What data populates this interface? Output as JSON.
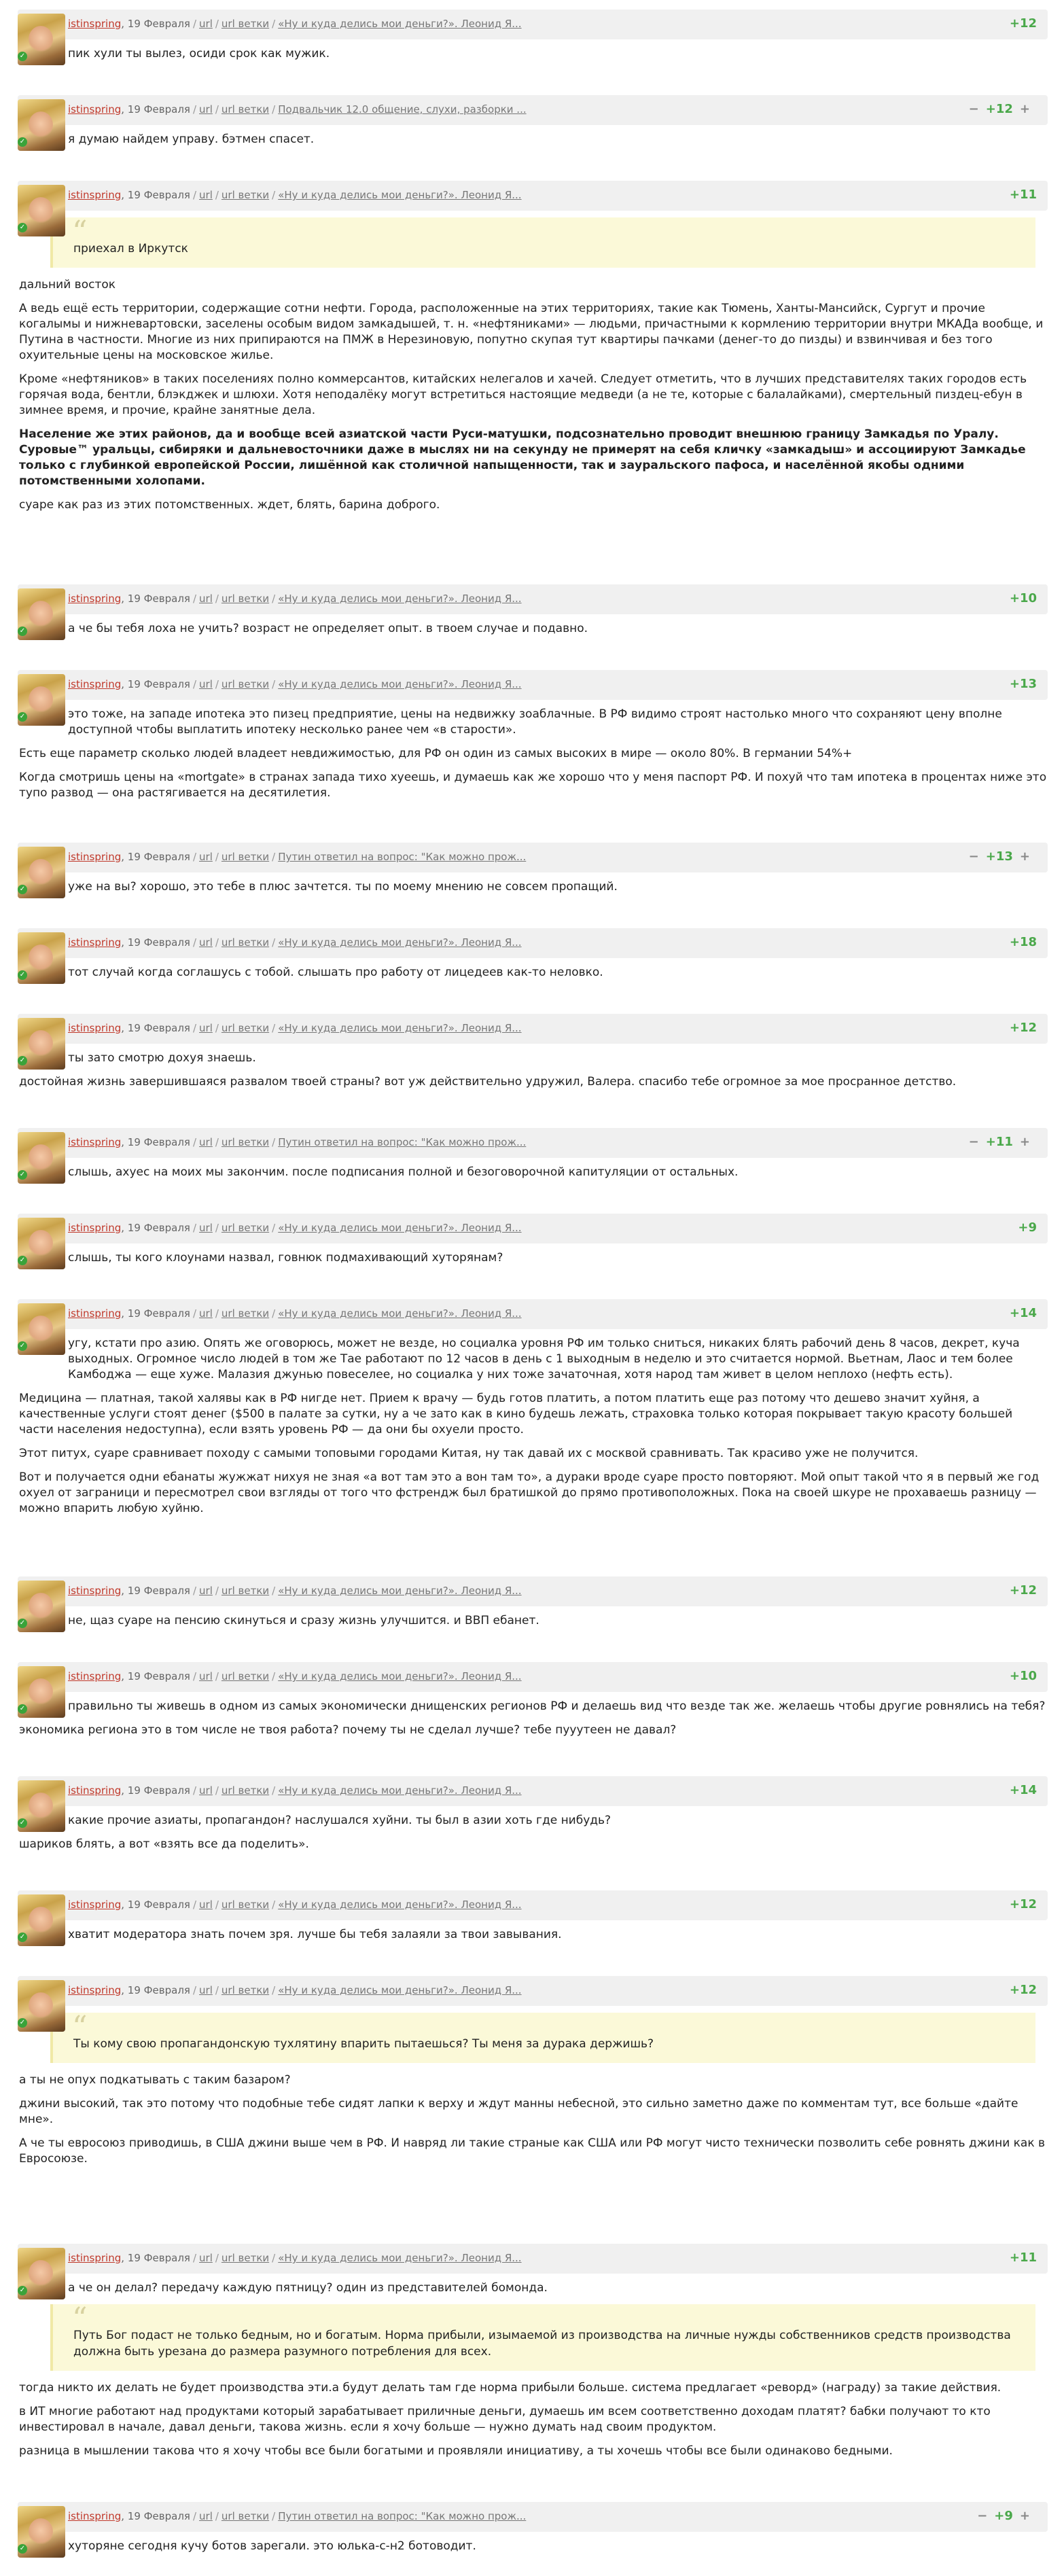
{
  "labels": {
    "user": "istinspring",
    "date": "19 Февраля",
    "url": "url",
    "branch": "url ветки",
    "sep": "/",
    "minus": "−",
    "plus": "+"
  },
  "comments": [
    {
      "thread": "«Ну и куда делись мои деньги?». Леонид Я...",
      "score": "+12",
      "controls": false,
      "body": [
        {
          "t": "пик хули ты вылез, осиди срок как мужик."
        }
      ]
    },
    {
      "thread": "Подвальчик 12.0 общение, слухи, разборки ...",
      "score": "+12",
      "controls": true,
      "body": [
        {
          "t": "я думаю найдем управу. бэтмен спасет."
        }
      ]
    },
    {
      "thread": "«Ну и куда делись мои деньги?». Леонид Я...",
      "score": "+11",
      "controls": false,
      "quote": "приехал в Иркутск",
      "body": [
        {
          "t": "дальний восток"
        },
        {
          "t": "А ведь ещё есть территории, содержащие сотни нефти. Города, расположенные на этих территориях, такие как Тюмень, Ханты-Мансийск, Сургут и прочие когалымы и нижневартовски, заселены особым видом замкадышей, т. н. «нефтяниками» — людьми, причастными к кормлению территории внутри МКАДа вообще, и Путина в частности. Многие из них припираются на ПМЖ в Нерезиновую, попутно скупая тут квартиры пачками (денег-то до пизды) и взвинчивая и без того охуительные цены на московское жилье."
        },
        {
          "t": "Кроме «нефтяников» в таких поселениях полно коммерсантов, китайских нелегалов и хачей. Следует отметить, что в лучших представителях таких городов есть горячая вода, бентли, блэкджек и шлюхи. Хотя неподалёку могут встретиться настоящие медведи (а не те, которые с балалайками), смертельный пиздец-ебун в зимнее время, и прочие, крайне занятные дела."
        },
        {
          "t": "Население же этих районов, да и вообще всей азиатской части Руси-матушки, подсознательно проводит внешнюю границу Замкадья по Уралу. Суровые™ уральцы, сибиряки и дальневосточники даже в мыслях ни на секунду не примерят на себя кличку «замкадыш» и ассоциируют Замкадье только с глубинкой европейской России, лишённой как столичной напыщенности, так и зауральского пафоса, и населённой якобы одними потомственными холопами.",
          "bold": true
        },
        {
          "t": "суаре как раз из этих потомственных. ждет, блять, барина доброго."
        }
      ]
    },
    {
      "thread": "«Ну и куда делись мои деньги?». Леонид Я...",
      "score": "+10",
      "controls": false,
      "body": [
        {
          "t": "а че бы тебя лоха не учить? возраст не определяет опыт. в твоем случае и подавно."
        }
      ]
    },
    {
      "thread": "«Ну и куда делись мои деньги?». Леонид Я...",
      "score": "+13",
      "controls": false,
      "body": [
        {
          "t": "это тоже, на западе ипотека это пизец предприятие, цены на недвижку зоаблачные. В РФ видимо строят настолько много что сохраняют цену вполне доступной чтобы выплатить ипотеку несколько ранее чем «в старости»."
        },
        {
          "t": "Есть еще параметр сколько людей владеет невдижимостью, для РФ он один из самых высоких в мире — около 80%. В германии 54%+"
        },
        {
          "t": "Когда смотришь цены на «mortgate» в странах запада тихо хуеешь, и думаешь как же хорошо что у меня паспорт РФ. И похуй что там ипотека в процентах ниже это тупо развод — она растягивается на десятилетия."
        }
      ]
    },
    {
      "thread": "Путин ответил на вопрос: \"Как можно прож...",
      "score": "+13",
      "controls": true,
      "body": [
        {
          "t": "уже на вы? хорошо, это тебе в плюс зачтется. ты по моему мнению не совсем пропащий."
        }
      ]
    },
    {
      "thread": "«Ну и куда делись мои деньги?». Леонид Я...",
      "score": "+18",
      "controls": false,
      "body": [
        {
          "t": "тот случай когда соглашусь с тобой. слышать про работу от лицедеев как-то неловко."
        }
      ]
    },
    {
      "thread": "«Ну и куда делись мои деньги?». Леонид Я...",
      "score": "+12",
      "controls": false,
      "body": [
        {
          "t": "ты зато смотрю дохуя знаешь."
        },
        {
          "t": "достойная жизнь завершившаяся развалом твоей страны? вот уж действительно удружил, Валера. спасибо тебе огромное за мое просранное детство."
        }
      ]
    },
    {
      "thread": "Путин ответил на вопрос: \"Как можно прож...",
      "score": "+11",
      "controls": true,
      "body": [
        {
          "t": "слышь, ахуес на моих мы закончим. после подписания полной и безоговорочной капитуляции от остальных."
        }
      ]
    },
    {
      "thread": "«Ну и куда делись мои деньги?». Леонид Я...",
      "score": "+9",
      "controls": false,
      "body": [
        {
          "t": "слышь, ты кого клоунами назвал, говнюк подмахивающий хуторянам?"
        }
      ]
    },
    {
      "thread": "«Ну и куда делись мои деньги?». Леонид Я...",
      "score": "+14",
      "controls": false,
      "body": [
        {
          "t": "угу, кстати про азию. Опять же оговорюсь, может не везде, но социалка уровня РФ им только сниться, никаких блять рабочий день 8 часов, декрет, куча выходных. Огромное число людей в том же Тае работают по 12 часов в день с 1 выходным в неделю и это считается нормой. Вьетнам, Лаос и тем более Камбоджа — еще хуже. Малазия джунью повеселее, но социалка у них тоже зачаточная, хотя народ там живет в целом неплохо (нефть есть)."
        },
        {
          "t": "Медицина — платная, такой халявы как в РФ нигде нет. Прием к врачу — будь готов платить, а потом платить еще раз потому что дешево значит хуйня, а качественные услуги стоят денег ($500 в палате за сутки, ну а че зато как в кино будешь лежать, страховка только которая покрывает такую красоту большей части населения недоступна), если взять уровень РФ — да они бы охуели просто."
        },
        {
          "t": "Этот питух, суаре сравнивает походу с самыми топовыми городами Китая, ну так давай их с москвой сравнивать. Так красиво уже не получится."
        },
        {
          "t": "Вот и получается одни ебанаты жужжат нихуя не зная «а вот там это а вон там то», а дураки вроде суаре просто повторяют. Мой опыт такой что я в первый же год охуел от заграници и пересмотрел свои взгляды от того что фстрендж был братишкой до прямо противоположных. Пока на своей шкуре не прохаваешь разницу — можно впарить любую хуйню."
        }
      ]
    },
    {
      "thread": "«Ну и куда делись мои деньги?». Леонид Я...",
      "score": "+12",
      "controls": false,
      "body": [
        {
          "t": "не, щаз суаре на пенсию скинуться и сразу жизнь улучшится. и ВВП ебанет."
        }
      ]
    },
    {
      "thread": "«Ну и куда делись мои деньги?». Леонид Я...",
      "score": "+10",
      "controls": false,
      "body": [
        {
          "t": "правильно ты живешь в одном из самых экономически днищенских регионов РФ и делаешь вид что везде так же. желаешь чтобы другие ровнялись на тебя?"
        },
        {
          "t": "экономика региона это в том числе не твоя работа? почему ты не сделал лучше? тебе пууутеен не давал?"
        }
      ]
    },
    {
      "thread": "«Ну и куда делись мои деньги?». Леонид Я...",
      "score": "+14",
      "controls": false,
      "body": [
        {
          "t": "какие прочие азиаты, пропагандон? наслушался хуйни. ты был в азии хоть где нибудь?"
        },
        {
          "t": "шариков блять, а вот «взять все да поделить»."
        }
      ]
    },
    {
      "thread": "«Ну и куда делись мои деньги?». Леонид Я...",
      "score": "+12",
      "controls": false,
      "body": [
        {
          "t": "хватит модератора знать почем зря. лучше бы тебя залаяли за твои завывания."
        }
      ]
    },
    {
      "thread": "«Ну и куда делись мои деньги?». Леонид Я...",
      "score": "+12",
      "controls": false,
      "quote": "Ты кому свою пропагандонскую тухлятину впарить пытаешься? Ты меня за дурака держишь?",
      "body": [
        {
          "t": "а ты не опух подкатывать с таким базаром?"
        },
        {
          "t": "джини высокий, так это потому что подобные тебе сидят лапки к верху и ждут манны небесной, это сильно заметно даже по комментам тут, все больше «дайте мне»."
        },
        {
          "t": "А че ты евросоюз приводишь, в США джини выше чем в РФ. И навряд ли такие страные как США или РФ могут чисто технически позволить себе ровнять джини как в Евросоюзе."
        }
      ]
    },
    {
      "thread": "«Ну и куда делись мои деньги?». Леонид Я...",
      "score": "+11",
      "controls": false,
      "body": [
        {
          "t": "а че он делал? передачу каждую пятницу? один из представителей бомонда."
        }
      ],
      "quote2": "Путь Бог подаст не только бедным, но и богатым. Норма прибыли, изымаемой из производства на личные нужды собственников средств производства должна быть урезана до размера разумного потребления для всех.",
      "body2": [
        {
          "t": "тогда никто их делать не будет производства эти.а будут делать там где норма прибыли больше. система предлагает «реворд» (награду) за такие действия."
        },
        {
          "t": "в ИТ многие работают над продуктами который зарабатывает приличные деньги, думаешь им всем соответственно доходам платят? бабки получают то кто инвестировал в начале, давал деньги, такова жизнь. если я хочу больше — нужно думать над своим продуктом."
        },
        {
          "t": "разница в мышлении такова что я хочу чтобы все были богатыми и проявляли инициативу, а ты хочешь чтобы все были одинаково бедными."
        }
      ]
    },
    {
      "thread": "Путин ответил на вопрос: \"Как можно прож...",
      "score": "+9",
      "controls": true,
      "body": [
        {
          "t": "хуторяне сегодня кучу ботов зарегали. это юлька-с-н2 ботоводит."
        }
      ]
    }
  ]
}
